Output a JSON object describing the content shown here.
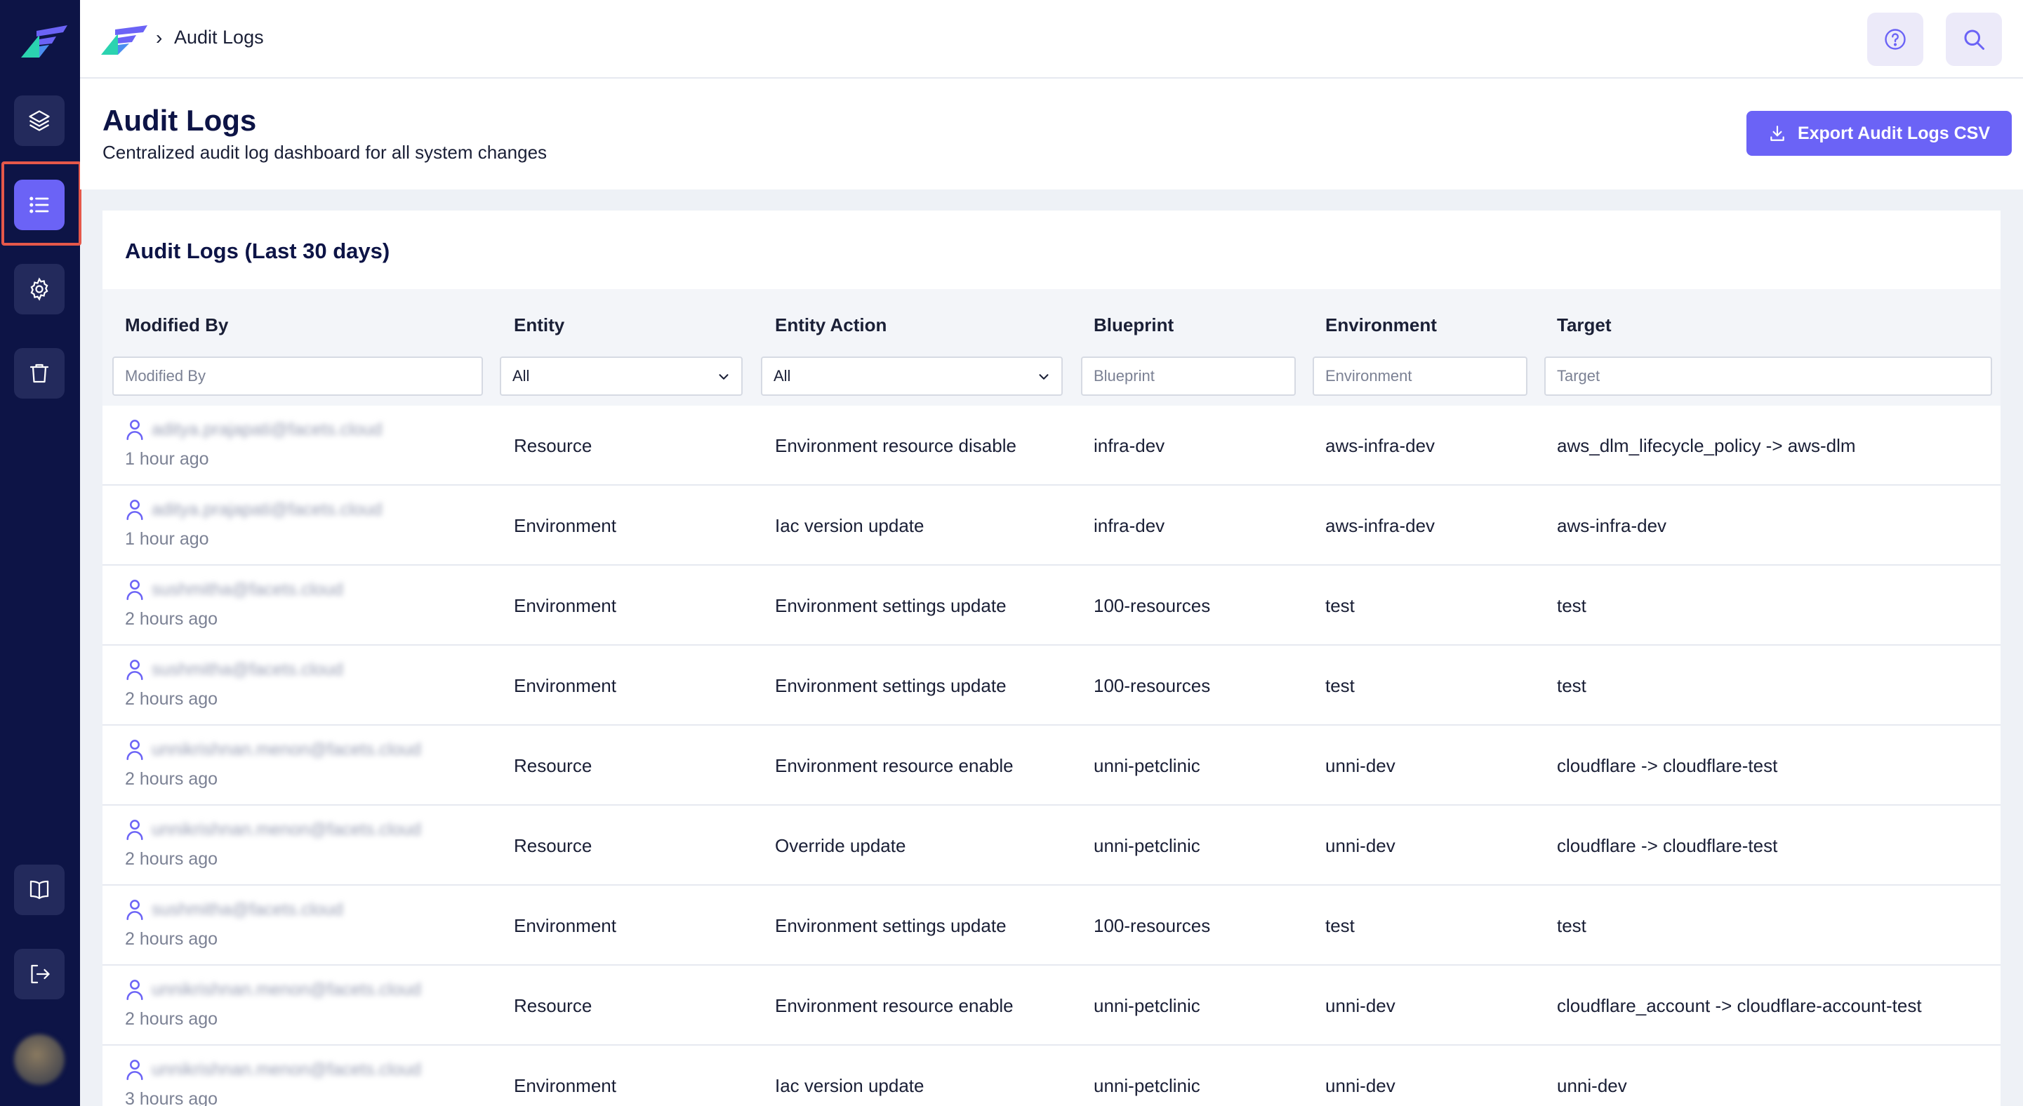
{
  "breadcrumb": {
    "current": "Audit Logs"
  },
  "page": {
    "title": "Audit Logs",
    "subtitle": "Centralized audit log dashboard for all system changes",
    "export_label": "Export Audit Logs CSV"
  },
  "card": {
    "title": "Audit Logs (Last 30 days)"
  },
  "columns": {
    "modified_by": "Modified By",
    "entity": "Entity",
    "entity_action": "Entity Action",
    "blueprint": "Blueprint",
    "environment": "Environment",
    "target": "Target"
  },
  "filters": {
    "modified_by_placeholder": "Modified By",
    "entity_value": "All",
    "entity_action_value": "All",
    "blueprint_placeholder": "Blueprint",
    "environment_placeholder": "Environment",
    "target_placeholder": "Target"
  },
  "rows": [
    {
      "email": "aditya.prajapati@facets.cloud",
      "time": "1 hour ago",
      "entity": "Resource",
      "action": "Environment resource disable",
      "blueprint": "infra-dev",
      "environment": "aws-infra-dev",
      "target": "aws_dlm_lifecycle_policy -> aws-dlm"
    },
    {
      "email": "aditya.prajapati@facets.cloud",
      "time": "1 hour ago",
      "entity": "Environment",
      "action": "Iac version update",
      "blueprint": "infra-dev",
      "environment": "aws-infra-dev",
      "target": "aws-infra-dev"
    },
    {
      "email": "sushmitha@facets.cloud",
      "time": "2 hours ago",
      "entity": "Environment",
      "action": "Environment settings update",
      "blueprint": "100-resources",
      "environment": "test",
      "target": "test"
    },
    {
      "email": "sushmitha@facets.cloud",
      "time": "2 hours ago",
      "entity": "Environment",
      "action": "Environment settings update",
      "blueprint": "100-resources",
      "environment": "test",
      "target": "test"
    },
    {
      "email": "unnikrishnan.menon@facets.cloud",
      "time": "2 hours ago",
      "entity": "Resource",
      "action": "Environment resource enable",
      "blueprint": "unni-petclinic",
      "environment": "unni-dev",
      "target": "cloudflare -> cloudflare-test"
    },
    {
      "email": "unnikrishnan.menon@facets.cloud",
      "time": "2 hours ago",
      "entity": "Resource",
      "action": "Override update",
      "blueprint": "unni-petclinic",
      "environment": "unni-dev",
      "target": "cloudflare -> cloudflare-test"
    },
    {
      "email": "sushmitha@facets.cloud",
      "time": "2 hours ago",
      "entity": "Environment",
      "action": "Environment settings update",
      "blueprint": "100-resources",
      "environment": "test",
      "target": "test"
    },
    {
      "email": "unnikrishnan.menon@facets.cloud",
      "time": "2 hours ago",
      "entity": "Resource",
      "action": "Environment resource enable",
      "blueprint": "unni-petclinic",
      "environment": "unni-dev",
      "target": "cloudflare_account -> cloudflare-account-test"
    },
    {
      "email": "unnikrishnan.menon@facets.cloud",
      "time": "3 hours ago",
      "entity": "Environment",
      "action": "Iac version update",
      "blueprint": "unni-petclinic",
      "environment": "unni-dev",
      "target": "unni-dev"
    }
  ]
}
